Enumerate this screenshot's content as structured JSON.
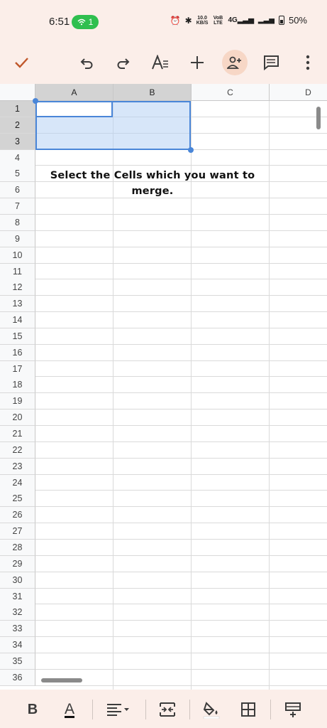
{
  "status_bar": {
    "time": "6:51",
    "hotspot_count": "1",
    "net_speed_value": "10.0",
    "net_speed_unit": "KB/S",
    "volte": "VoB LTE",
    "network": "4G",
    "battery": "50%"
  },
  "toolbar": {
    "icons": [
      "check-icon",
      "undo-icon",
      "redo-icon",
      "text-format-icon",
      "add-icon",
      "share-person-add-icon",
      "comment-icon",
      "more-vert-icon"
    ]
  },
  "sheet": {
    "columns": [
      "A",
      "B",
      "C",
      "D"
    ],
    "rows": [
      "1",
      "2",
      "3",
      "4",
      "5",
      "6",
      "7",
      "8",
      "9",
      "10",
      "11",
      "12",
      "13",
      "14",
      "15",
      "16",
      "17",
      "18",
      "19",
      "20",
      "21",
      "22",
      "23",
      "24",
      "25",
      "26",
      "27",
      "28",
      "29",
      "30",
      "31",
      "32",
      "33",
      "34",
      "35",
      "36"
    ],
    "selected_range": "A1:B3",
    "overlay_text": "Select the Cells which you want to merge."
  },
  "bottom_toolbar": {
    "bold_label": "B",
    "text_color_label": "A",
    "icons": [
      "bold-icon",
      "text-color-icon",
      "align-icon",
      "merge-cells-icon",
      "fill-color-icon",
      "borders-icon",
      "insert-row-icon"
    ]
  },
  "colors": {
    "accent": "#4a86d8",
    "toolbar_bg": "#fbeee9",
    "check": "#c0572a"
  }
}
